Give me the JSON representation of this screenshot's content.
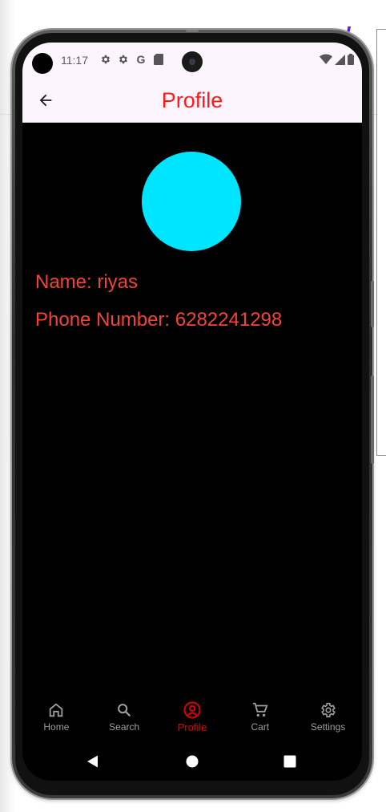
{
  "background": {
    "brand_fragment": "o!"
  },
  "status_bar": {
    "time": "11:17",
    "icons": [
      "settings-gear-icon",
      "settings-gear-icon",
      "google-g-icon",
      "sd-card-icon"
    ],
    "right_icons": [
      "wifi-icon",
      "signal-icon",
      "battery-icon"
    ],
    "google_glyph": "G"
  },
  "app_bar": {
    "title": "Profile",
    "back_icon": "arrow-back-icon",
    "title_color": "#ff1a1a",
    "background": "#fdf5fd"
  },
  "profile": {
    "avatar_color": "#00e5ff",
    "name_line": "Name: riyas",
    "phone_line": "Phone Number: 6282241298",
    "text_color": "#f44336"
  },
  "bottom_nav": {
    "items": [
      {
        "label": "Home",
        "icon": "home-icon",
        "active": false
      },
      {
        "label": "Search",
        "icon": "search-icon",
        "active": false
      },
      {
        "label": "Profile",
        "icon": "account-circle-icon",
        "active": true
      },
      {
        "label": "Cart",
        "icon": "shopping-cart-icon",
        "active": false
      },
      {
        "label": "Settings",
        "icon": "settings-icon",
        "active": false
      }
    ],
    "active_color": "#e00000",
    "inactive_color": "#9e9e9e"
  },
  "system_nav": {
    "buttons": [
      "back-triangle-icon",
      "home-circle-icon",
      "recents-square-icon"
    ]
  }
}
